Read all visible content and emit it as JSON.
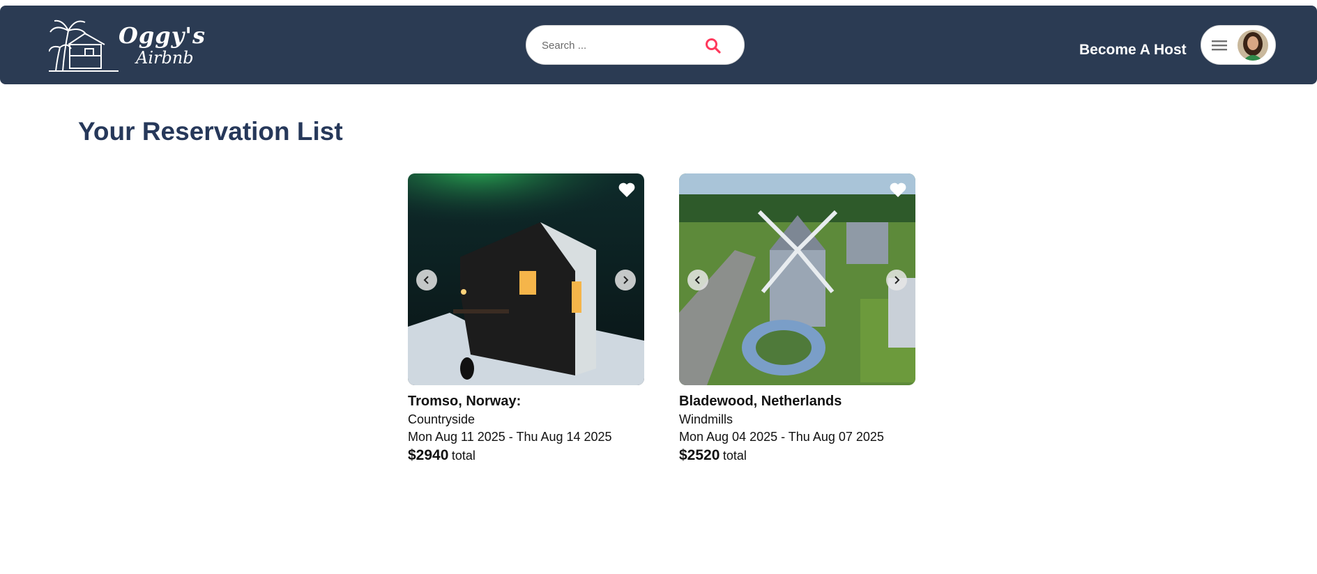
{
  "header": {
    "logo_line1": "Oggy's",
    "logo_line2": "Airbnb",
    "search_placeholder": "Search ...",
    "become_host": "Become A Host",
    "accent_color": "#ff385c",
    "nav_color": "#2b3b53"
  },
  "page": {
    "title": "Your Reservation List"
  },
  "reservations": [
    {
      "location": "Tromso, Norway:",
      "category": "Countryside",
      "dates": "Mon Aug 11 2025 - Thu Aug 14 2025",
      "price": "$2940",
      "price_suffix": "total"
    },
    {
      "location": "Bladewood, Netherlands",
      "category": "Windmills",
      "dates": "Mon Aug 04 2025 - Thu Aug 07 2025",
      "price": "$2520",
      "price_suffix": "total"
    }
  ]
}
